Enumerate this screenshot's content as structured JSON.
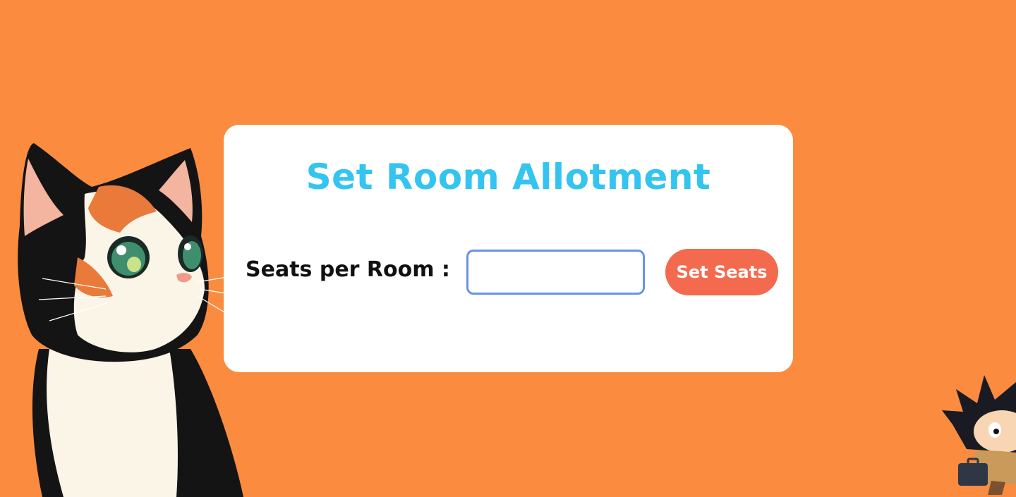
{
  "colors": {
    "background": "#fa8b3f",
    "card": "#ffffff",
    "title": "#34c4f0",
    "button": "#f46a4e",
    "button_text": "#ffffff",
    "input_border": "#6a92e6",
    "label": "#111111"
  },
  "card": {
    "title": "Set Room Allotment",
    "field_label": "Seats per Room :",
    "input_value": "",
    "input_placeholder": "",
    "button_label": "Set Seats"
  },
  "illustrations": {
    "left": "calico-cat-illustration",
    "right": "running-cartoon-character-illustration"
  }
}
